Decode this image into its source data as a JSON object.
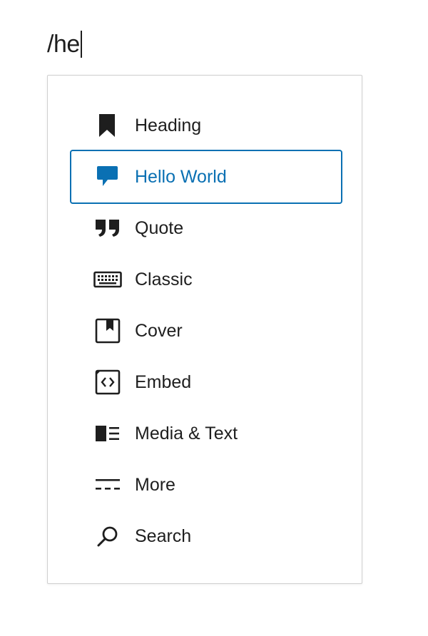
{
  "editor": {
    "typed_text": "/he"
  },
  "autocomplete": {
    "selected_index": 1,
    "accent_color": "#0a70b3",
    "items": [
      {
        "label": "Heading",
        "icon": "bookmark-icon"
      },
      {
        "label": "Hello World",
        "icon": "speech-bubble-icon"
      },
      {
        "label": "Quote",
        "icon": "quote-icon"
      },
      {
        "label": "Classic",
        "icon": "keyboard-icon"
      },
      {
        "label": "Cover",
        "icon": "cover-icon"
      },
      {
        "label": "Embed",
        "icon": "embed-icon"
      },
      {
        "label": "Media & Text",
        "icon": "media-text-icon"
      },
      {
        "label": "More",
        "icon": "more-icon"
      },
      {
        "label": "Search",
        "icon": "search-icon"
      }
    ]
  }
}
